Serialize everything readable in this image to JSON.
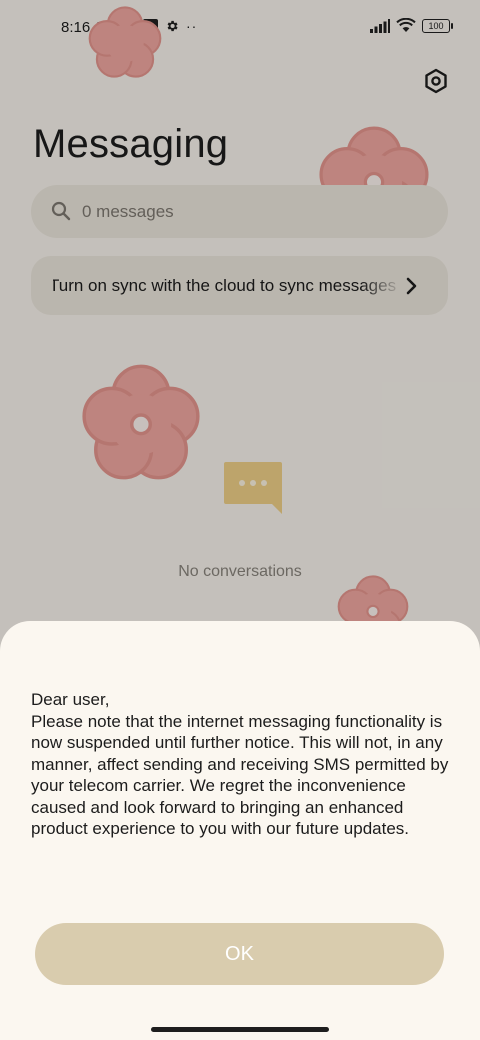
{
  "status_bar": {
    "time": "8:16 AM",
    "battery": "100",
    "icons": [
      "data-saver-icon",
      "square-icon",
      "gear-icon",
      "more-dots-icon",
      "signal-icon",
      "wifi-icon",
      "battery-icon"
    ]
  },
  "header": {
    "title": "Messaging",
    "settings_icon": "hexagon-settings-icon"
  },
  "search": {
    "placeholder": "0 messages"
  },
  "sync_banner": {
    "text": "Turn on sync with the cloud to sync messages"
  },
  "empty_state": {
    "text": "No conversations"
  },
  "dialog": {
    "greeting": "Dear user,",
    "body": "Please note that the internet messaging functionality is now suspended until further notice. This will not, in any manner, affect sending and receiving SMS permitted by your telecom carrier. We regret the inconvenience caused and look forward to bringing an enhanced product experience to you with our future updates.",
    "ok_label": "OK"
  },
  "colors": {
    "background": "#fbf7f0",
    "card": "#efe9df",
    "button": "#d9ccae",
    "flower": "#f2a8a0",
    "chat_icon": "#f3d38a"
  }
}
